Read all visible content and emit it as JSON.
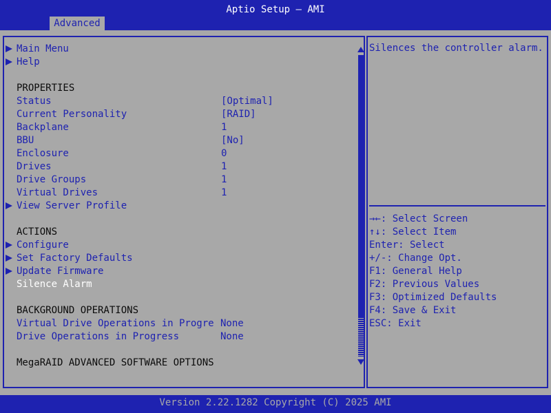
{
  "header": {
    "title": "Aptio Setup – AMI",
    "tab": "Advanced"
  },
  "menu": {
    "links": [
      {
        "label": "Main Menu"
      },
      {
        "label": "Help"
      }
    ],
    "properties_header": "PROPERTIES",
    "properties": [
      {
        "label": "Status",
        "value": "[Optimal]"
      },
      {
        "label": "Current Personality",
        "value": "[RAID]"
      },
      {
        "label": "Backplane",
        "value": "1"
      },
      {
        "label": "BBU",
        "value": "[No]"
      },
      {
        "label": "Enclosure",
        "value": "0"
      },
      {
        "label": "Drives",
        "value": "1"
      },
      {
        "label": "Drive Groups",
        "value": "1"
      },
      {
        "label": "Virtual Drives",
        "value": "1"
      }
    ],
    "view_server_profile": "View Server Profile",
    "actions_header": "ACTIONS",
    "actions": [
      {
        "label": "Configure"
      },
      {
        "label": "Set Factory Defaults"
      },
      {
        "label": "Update Firmware"
      }
    ],
    "selected_item": "Silence Alarm",
    "bg_header": "BACKGROUND OPERATIONS",
    "bg_ops": [
      {
        "label": "Virtual Drive Operations in Progre",
        "value": "None"
      },
      {
        "label": "Drive Operations in Progress",
        "value": "None"
      }
    ],
    "megaraid_header": "MegaRAID ADVANCED SOFTWARE OPTIONS"
  },
  "help": {
    "description": "Silences the controller alarm.",
    "keys": [
      "→←: Select Screen",
      "↑↓: Select Item",
      "Enter: Select",
      "+/-: Change Opt.",
      "F1: General Help",
      "F2: Previous Values",
      "F3: Optimized Defaults",
      "F4: Save & Exit",
      "ESC: Exit"
    ]
  },
  "footer": {
    "version": "Version 2.22.1282 Copyright (C) 2025 AMI"
  },
  "colors": {
    "bg": "#a8a8a8",
    "accent": "#1e22b0",
    "selected": "#ffffff",
    "header": "#0b0b0b"
  },
  "icons": {
    "submenu": "submenu-arrow-icon",
    "scroll_up": "scroll-up-icon",
    "scroll_down": "scroll-down-icon"
  }
}
